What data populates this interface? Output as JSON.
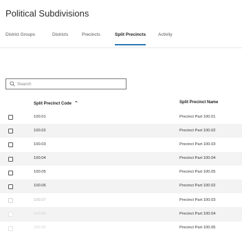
{
  "page": {
    "title": "Political Subdivisions"
  },
  "tabs": [
    {
      "label": "District Groups",
      "active": false
    },
    {
      "label": "Districts",
      "active": false
    },
    {
      "label": "Precincts",
      "active": false
    },
    {
      "label": "Split Precincts",
      "active": true
    },
    {
      "label": "Activity",
      "active": false
    }
  ],
  "search": {
    "placeholder": "Search",
    "value": "",
    "icon": "search-icon"
  },
  "table": {
    "columns": {
      "code": "Split Precinct Code",
      "name": "Split Precinct Name"
    },
    "sort": {
      "column": "code",
      "direction": "ascending",
      "icon": "caret-up-icon"
    },
    "rows": [
      {
        "code": "100.01",
        "name": "Precinct Part 100.01"
      },
      {
        "code": "100.02",
        "name": "Precinct Part 100.02"
      },
      {
        "code": "100.03",
        "name": "Precinct Part 100.03"
      },
      {
        "code": "100.04",
        "name": "Precinct Part 100.04"
      },
      {
        "code": "100.05",
        "name": "Precinct Part 100.05"
      },
      {
        "code": "100.06",
        "name": "Precinct Part 100.02"
      },
      {
        "code": "100.07",
        "name": "Precinct Part 100.03"
      },
      {
        "code": "100.08",
        "name": "Precinct Part 100.04"
      },
      {
        "code": "100.05",
        "name": "Precinct Part 100.05"
      }
    ]
  },
  "colors": {
    "accent": "#2a78b5",
    "row_alt": "#f3f3f3"
  }
}
